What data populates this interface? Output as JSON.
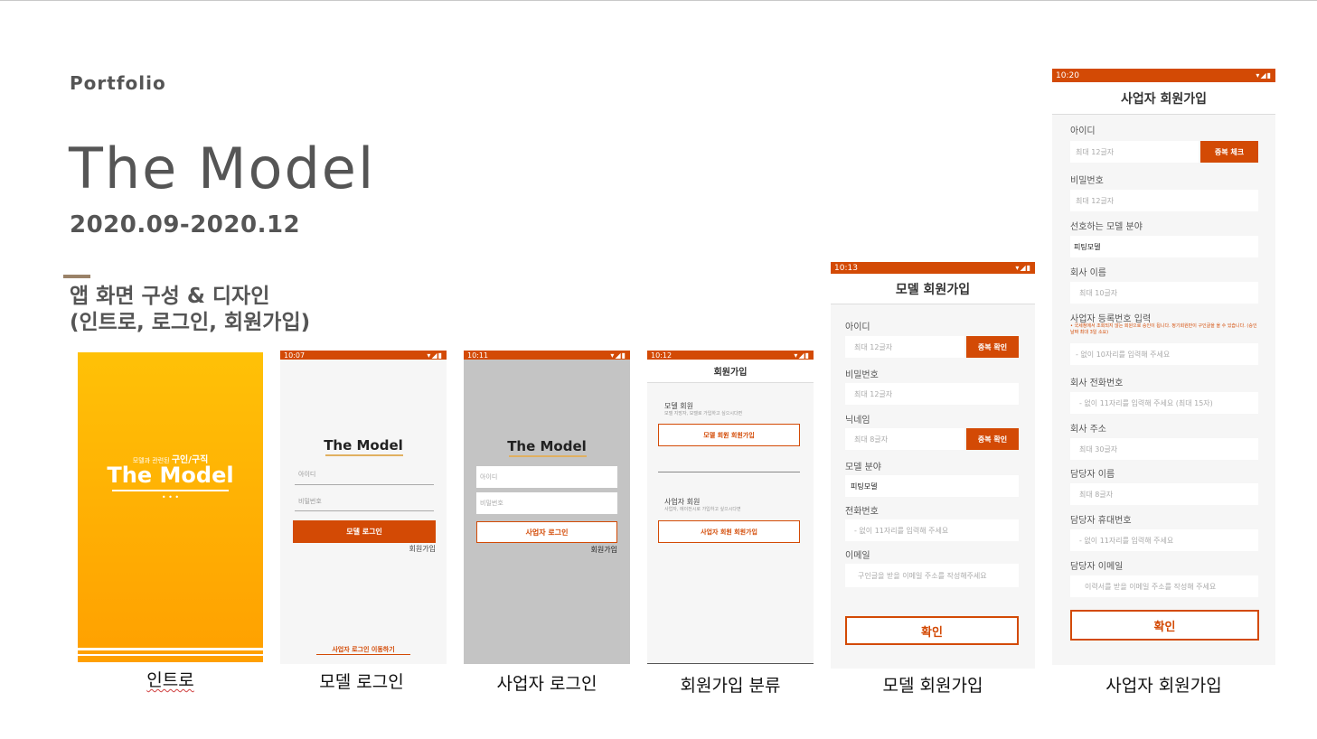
{
  "header": {
    "portfolio": "Portfolio",
    "title": "The Model",
    "date": "2020.09-2020.12",
    "subtitle_line1": "앱 화면 구성 & 디자인",
    "subtitle_line2": "(인트로, 로그인, 회원가입)"
  },
  "captions": {
    "intro": "인트로",
    "model_login": "모델 로그인",
    "biz_login": "사업자 로그인",
    "signup_type": "회원가입 분류",
    "model_signup": "모델 회원가입",
    "biz_signup": "사업자 회원가입"
  },
  "intro": {
    "tagline_prefix": "모델과 관련된",
    "tagline_main": "구인/구직",
    "logo": "The Model",
    "dots": "•  •  •"
  },
  "model_login": {
    "time": "10:07",
    "logo": "The Model",
    "id_placeholder": "아이디",
    "pw_placeholder": "비밀번호",
    "login_button": "모델 로그인",
    "signup_link": "회원가입",
    "switch_link": "사업자 로그인 이동하기"
  },
  "biz_login": {
    "time": "10:11",
    "logo": "The Model",
    "id_placeholder": "아이디",
    "pw_placeholder": "비밀번호",
    "login_button": "사업자 로그인",
    "signup_link": "회원가입"
  },
  "signup_type": {
    "time": "10:12",
    "title": "회원가입",
    "model_label": "모델 회원",
    "model_desc": "모델 지망자, 모델로 가입하고 싶으시다면",
    "model_button": "모델 회원 회원가입",
    "biz_label": "사업자 회원",
    "biz_desc": "사업자, 에이전시로 가입하고 싶으시다면",
    "biz_button": "사업자 회원 회원가입"
  },
  "model_signup": {
    "time": "10:13",
    "title": "모델 회원가입",
    "id_label": "아이디",
    "id_placeholder": "최대 12글자",
    "dup_check": "중복 확인",
    "pw_label": "비밀번호",
    "pw_placeholder": "최대 12글자",
    "nick_label": "닉네임",
    "nick_placeholder": "최대 8글자",
    "dup_check2": "중복 확인",
    "field_label": "모델 분야",
    "field_value": "피팅모델",
    "phone_label": "전화번호",
    "phone_placeholder": "- 없이 11자리를 입력해 주세요",
    "email_label": "이메일",
    "email_placeholder": "구인글을 받을 이메일 주소를 작성해주세요",
    "confirm": "확인"
  },
  "biz_signup": {
    "time": "10:20",
    "title": "사업자 회원가입",
    "id_label": "아이디",
    "id_placeholder": "최대 12글자",
    "dup_check": "중복 체크",
    "pw_label": "비밀번호",
    "pw_placeholder": "최대 12글자",
    "pref_label": "선호하는 모델 분야",
    "pref_value": "피팅모델",
    "company_label": "회사 이름",
    "company_placeholder": "최대 10글자",
    "regno_label": "사업자 등록번호 입력",
    "regno_note": "• 국세청에서 조회되지 않는 회원으로 승인이 됩니다. 정기회원만이 구인글을 올 수 있습니다. (승인날짜 최대 3일 소요)",
    "regno_placeholder": "- 없이 10자리를 입력해 주세요",
    "tel_label": "회사 전화번호",
    "tel_placeholder": "- 없이 11자리를 입력해 주세요 (최대 15자)",
    "addr_label": "회사 주소",
    "addr_placeholder": "최대 30글자",
    "manager_label": "담당자 이름",
    "manager_placeholder": "최대 8글자",
    "mobile_label": "담당자 휴대번호",
    "mobile_placeholder": "- 없이 11자리를 입력해 주세요",
    "email_label": "담당자 이메일",
    "email_placeholder": "이력서를 받을 이메일 주소를 작성해 주세요",
    "confirm": "확인"
  },
  "status_icons": "▾◢▮",
  "colors": {
    "brand": "#d34a05",
    "intro_top": "#ffc107",
    "intro_bottom": "#ffa000"
  }
}
